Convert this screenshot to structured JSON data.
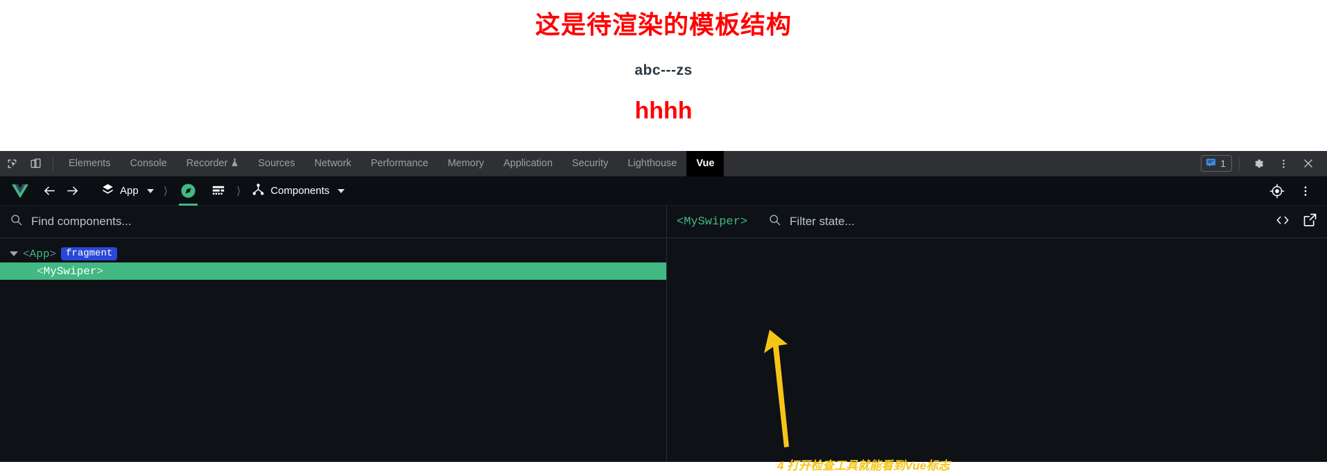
{
  "page": {
    "title": "这是待渲染的模板结构",
    "subtitle": "abc---zs",
    "heading": "hhhh",
    "title_color": "#ff0000",
    "subtitle_color": "#2b3a45",
    "heading_color": "#ff0000"
  },
  "devtools": {
    "left_icons": [
      {
        "name": "inspect-element-icon"
      },
      {
        "name": "device-toolbar-icon"
      }
    ],
    "tabs": [
      {
        "label": "Elements",
        "active": false
      },
      {
        "label": "Console",
        "active": false
      },
      {
        "label": "Recorder",
        "active": false,
        "badge_icon": "flask-icon"
      },
      {
        "label": "Sources",
        "active": false
      },
      {
        "label": "Network",
        "active": false
      },
      {
        "label": "Performance",
        "active": false
      },
      {
        "label": "Memory",
        "active": false
      },
      {
        "label": "Application",
        "active": false
      },
      {
        "label": "Security",
        "active": false
      },
      {
        "label": "Lighthouse",
        "active": false
      },
      {
        "label": "Vue",
        "active": true
      }
    ],
    "issues_count": "1",
    "right_icons": [
      {
        "name": "issues-icon"
      },
      {
        "name": "settings-gear-icon"
      },
      {
        "name": "more-options-icon"
      },
      {
        "name": "close-devtools-icon"
      }
    ]
  },
  "vue_toolbar": {
    "logo_name": "vue-logo-icon",
    "back_label": "back-arrow-icon",
    "forward_label": "forward-arrow-icon",
    "app_label": "App",
    "inspector_icon": "compass-inspector-icon",
    "timeline_icon": "component-data-icon",
    "view_label": "Components",
    "target_icon": "select-component-target-icon",
    "menu_icon": "vue-more-options-icon"
  },
  "component_search": {
    "placeholder": "Find components...",
    "value": "",
    "icon": "search-icon"
  },
  "state_panel": {
    "selected_component": "<MySwiper>",
    "filter_placeholder": "Filter state...",
    "filter_value": "",
    "icon": "search-icon",
    "actions": [
      {
        "name": "open-in-editor-code-icon"
      },
      {
        "name": "detach-window-icon"
      }
    ]
  },
  "component_tree": [
    {
      "tag": "<App>",
      "open_bracket": "<",
      "name": "App",
      "close_bracket": ">",
      "badge": "fragment",
      "selected": false,
      "depth": 0,
      "expanded": true
    },
    {
      "tag": "<MySwiper>",
      "open_bracket": "<",
      "name": "MySwiper",
      "close_bracket": ">",
      "badge": "",
      "selected": true,
      "depth": 1,
      "expanded": false
    }
  ],
  "annotation": {
    "text": "4 打开检查工具就能看到Vue标志",
    "color": "#f5c518",
    "arrow_name": "annotation-arrow"
  },
  "colors": {
    "devtools_tabbar_bg": "#2f3033",
    "vue_panel_bg": "#0e1116",
    "vue_green": "#42b883",
    "fragment_badge_blue": "#2948d8",
    "annotation_yellow": "#f5c518"
  }
}
